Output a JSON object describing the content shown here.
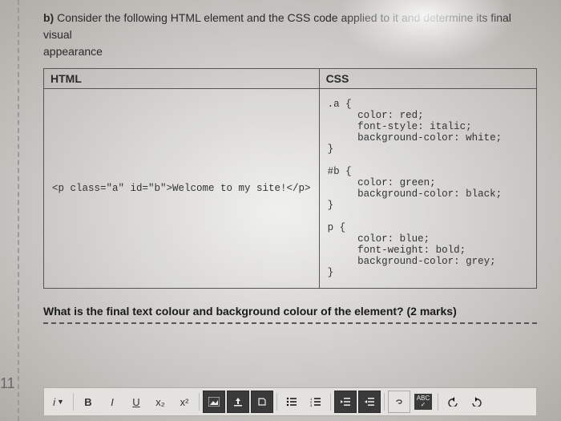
{
  "question": {
    "part": "b)",
    "prompt_line1": "Consider the following HTML element and the CSS code applied to it and determine its final visual",
    "prompt_line2": "appearance",
    "followup": "What is the final text colour and background colour of the element? (2 marks)"
  },
  "table": {
    "col1": "HTML",
    "col2": "CSS",
    "html_code": "<p class=\"a\" id=\"b\">Welcome to my site!</p>",
    "css_code": ".a {\n     color: red;\n     font-style: italic;\n     background-color: white;\n}\n\n#b {\n     color: green;\n     background-color: black;\n}\n\np {\n     color: blue;\n     font-weight: bold;\n     background-color: grey;\n}"
  },
  "sidebar": {
    "question_number": "11"
  },
  "toolbar": {
    "style_label": "i",
    "bold": "B",
    "italic": "I",
    "underline": "U",
    "sub": "x₂",
    "sup": "x²",
    "abc": "ABC"
  }
}
